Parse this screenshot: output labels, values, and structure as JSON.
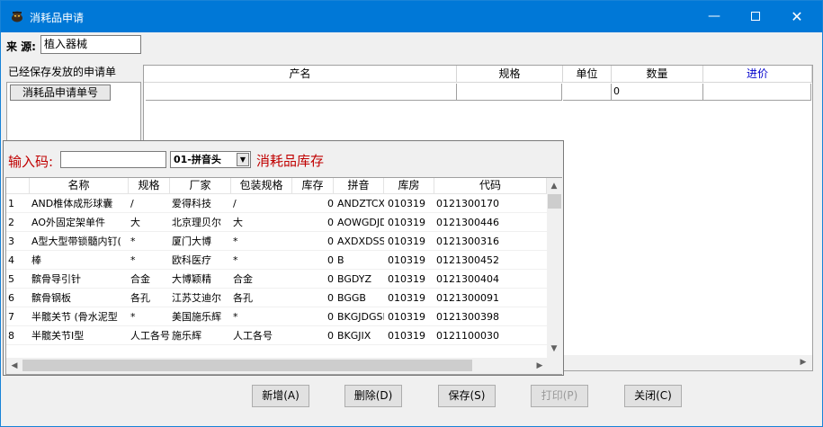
{
  "window": {
    "title": "消耗品申请"
  },
  "source": {
    "label": "来 源:",
    "value": "植入器械"
  },
  "saved_list": {
    "caption": "已经保存发放的申请单",
    "header": "消耗品申请单号"
  },
  "main_table": {
    "headers": [
      "产名",
      "规格",
      "单位",
      "数量",
      "进价"
    ],
    "row": [
      "",
      "",
      "",
      "0",
      ""
    ]
  },
  "lookup": {
    "input_label": "输入码:",
    "input_value": "",
    "mode_select": "01-拼音头",
    "stock_label": "消耗品库存",
    "headers": [
      "名称",
      "规格",
      "厂家",
      "包装规格",
      "库存",
      "拼音",
      "库房",
      "代码"
    ],
    "rows": [
      [
        "1",
        "AND椎体成形球囊",
        "/",
        "爱得科技",
        "/",
        "0",
        "ANDZTCXQ",
        "010319",
        "0121300170"
      ],
      [
        "2",
        "AO外固定架单件",
        "大",
        "北京理贝尔",
        "大",
        "0",
        "AOWGDJDJ",
        "010319",
        "0121300446"
      ],
      [
        "3",
        "A型大型带锁髓内钉(",
        "*",
        "厦门大博",
        "*",
        "0",
        "AXDXDSSN",
        "010319",
        "0121300316"
      ],
      [
        "4",
        "棒",
        "*",
        "欧科医疗",
        "*",
        "0",
        "B",
        "010319",
        "0121300452"
      ],
      [
        "5",
        "髌骨导引针",
        "合金",
        "大博颖精",
        "合金",
        "0",
        "BGDYZ",
        "010319",
        "0121300404"
      ],
      [
        "6",
        "髌骨钢板",
        "各孔",
        "江苏艾迪尔",
        "各孔",
        "0",
        "BGGB",
        "010319",
        "0121300091"
      ],
      [
        "7",
        "半髋关节 (骨水泥型",
        "*",
        "美国施乐辉",
        "*",
        "0",
        "BKGJDGSN",
        "010319",
        "0121300398"
      ],
      [
        "8",
        "半髋关节I型",
        "人工各号",
        "施乐辉",
        "人工各号",
        "0",
        "BKGJIX",
        "010319",
        "0121100030"
      ]
    ]
  },
  "buttons": {
    "add": "新增(A)",
    "delete": "删除(D)",
    "save": "保存(S)",
    "print": "打印(P)",
    "close": "关闭(C)"
  },
  "icons": {
    "minimize": "minimize-icon",
    "maximize": "maximize-icon",
    "close": "close-icon"
  },
  "colors": {
    "titlebar": "#0078d7",
    "lookup_label": "#c00000",
    "price_header": "#0000cc"
  }
}
